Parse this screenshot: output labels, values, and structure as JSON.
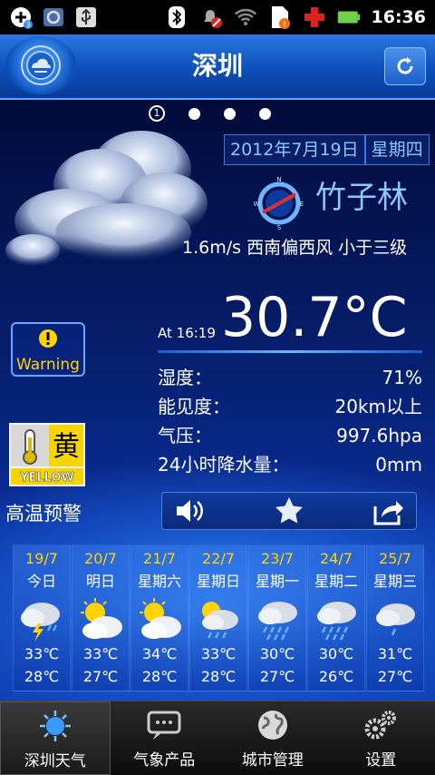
{
  "status_bar": {
    "time": "16:36",
    "notification_count": "3"
  },
  "header": {
    "title": "深圳"
  },
  "pager": {
    "current_page": "1",
    "page_count": 4
  },
  "current": {
    "date": "2012年7月19日",
    "weekday": "星期四",
    "station": "竹子林",
    "wind": "1.6m/s 西南偏西风 小于三级",
    "compass_letters": {
      "n": "N",
      "e": "E",
      "s": "S",
      "w": "W"
    },
    "observed_at": "At 16:19",
    "temperature": "30.7°C",
    "stats": [
      {
        "label": "湿度：",
        "value": "71%"
      },
      {
        "label": "能见度：",
        "value": "20km以上"
      },
      {
        "label": "气压：",
        "value": "997.6hpa"
      },
      {
        "label": "24小时降水量：",
        "value": "0mm"
      }
    ]
  },
  "warning": {
    "button_label": "Warning",
    "sign_char": "黄",
    "sign_text": "YELLOW",
    "alert_text": "高温预警"
  },
  "forecast": [
    {
      "date": "19/7",
      "day": "今日",
      "icon": "thunderstorm-icon",
      "high": "33℃",
      "low": "28℃"
    },
    {
      "date": "20/7",
      "day": "明日",
      "icon": "partly-cloudy-icon",
      "high": "33℃",
      "low": "27℃"
    },
    {
      "date": "21/7",
      "day": "星期六",
      "icon": "partly-cloudy-icon",
      "high": "34℃",
      "low": "28℃"
    },
    {
      "date": "22/7",
      "day": "星期日",
      "icon": "sun-rain-icon",
      "high": "33℃",
      "low": "28℃"
    },
    {
      "date": "23/7",
      "day": "星期一",
      "icon": "rain-icon",
      "high": "30℃",
      "low": "27℃"
    },
    {
      "date": "24/7",
      "day": "星期二",
      "icon": "rain-icon",
      "high": "30℃",
      "low": "26℃"
    },
    {
      "date": "25/7",
      "day": "星期三",
      "icon": "light-rain-icon",
      "high": "31℃",
      "low": "27℃"
    }
  ],
  "bottom_nav": [
    {
      "label": "深圳天气",
      "icon": "sun-icon",
      "active": true
    },
    {
      "label": "气象产品",
      "icon": "message-icon",
      "active": false
    },
    {
      "label": "城市管理",
      "icon": "globe-icon",
      "active": false
    },
    {
      "label": "设置",
      "icon": "gears-icon",
      "active": false
    }
  ],
  "colors": {
    "accent": "#8ec6ff",
    "warning_yellow": "#ffd400",
    "header_blue": "#0d4fb8"
  }
}
